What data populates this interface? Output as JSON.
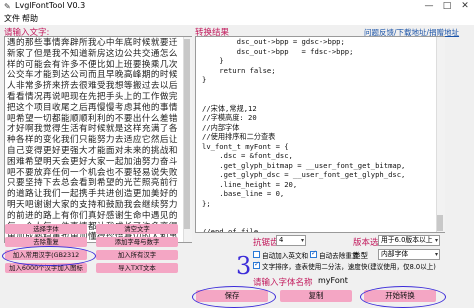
{
  "window": {
    "title": "LvglFontTool V0.3",
    "app_icon": "pin-icon",
    "controls": [
      "minimize-icon",
      "maximize-icon",
      "close-icon"
    ]
  },
  "menu": [
    "文件",
    "帮助"
  ],
  "links": "问题反馈/下载地址/捐赠地址",
  "input": {
    "label": "请输入文字:",
    "text": "遇的那些事情奔辟所我心中年底时候就要迁新家了但是我不知道新房这边公共交通怎么样的可能会有许多不便比如上班要换乘几次公交车才能到达公司而且早晚高峰期的时候人非常多挤来挤去很难受我想等搬过去以后看看情况再说吧现在先把手头上的工作做完把这个项目收尾之后再慢慢考虑其他的事情吧希望一切都能顺顺利利的不要出什么差错才好啊我觉得生活有时候就是这样充满了各种各样的变化我们只能努力去适应它然后让自己变得更好更强大才能面对未来的挑战和困难希望明天会更好大家一起加油努力奋斗吧不要放弃任何一个机会也不要轻易说失败只要坚持下去总会看到希望的光芒照亮前行的道路让我们一起携手共进创造更加美好的明天吧谢谢大家的支持和鼓励我会继续努力的前进的路上有你们真好感谢生命中遇见的每一个人每一件事情都让我成长了许多变得更加成熟稳重也更加懂得珍惜身边的人和事物未来的日子里我们继续加油吧一起创造属于我们的精彩人生aa"
  },
  "result": {
    "label": "转换结果",
    "code": "        dsc_out->bpp = gdsc->bpp;\n        dsc_out->bpp   = fdsc->bpp;\n    }\n    return false;\n}\n\n\n//宋体,常规,12\n//字模高度: 20\n//内部字体\n//使用排序和二分查表\nlv_font_t myFont = {\n    .dsc = &font_dsc,\n    .get_glyph_bitmap = __user_font_get_bitmap,\n    .get_glyph_dsc = __user_font_get_glyph_dsc,\n    .line_height = 20,\n    .base_line = 0,\n};\n\n\n//end of file"
  },
  "buttons_left": {
    "select_font": "选择字体",
    "clear_text": "清空文字",
    "remove_dup": "去除重复",
    "add_letters_digits": "添加字母与数字",
    "add_common_chinese": "加入常用汉字(GB2312 6763个)",
    "add_all_chinese": "加入所有汉字",
    "add_n_chars": "加入6000个汉字",
    "add_icons": "加入图标",
    "import_txt": "导入TXT文本"
  },
  "settings": {
    "aa_label": "抗锯齿",
    "aa_value": "4",
    "version_label": "版本选择",
    "version_value": "用于6.0版本以上",
    "type_label": "类型",
    "type_value": "内部字体",
    "checkboxes": [
      {
        "label": "自动加入英文和",
        "checked": false
      },
      {
        "label": "自动去除重复",
        "checked": true
      },
      {
        "label": "文字排序，查表使用二分法，速度快(建议使用，仅8.0以上)",
        "checked": true
      }
    ],
    "font_name_label": "请输入字体名称",
    "font_name_value": "myFont"
  },
  "actions": {
    "save": "保存",
    "copy": "复制",
    "start_convert": "开始转换"
  },
  "annotation": "3"
}
